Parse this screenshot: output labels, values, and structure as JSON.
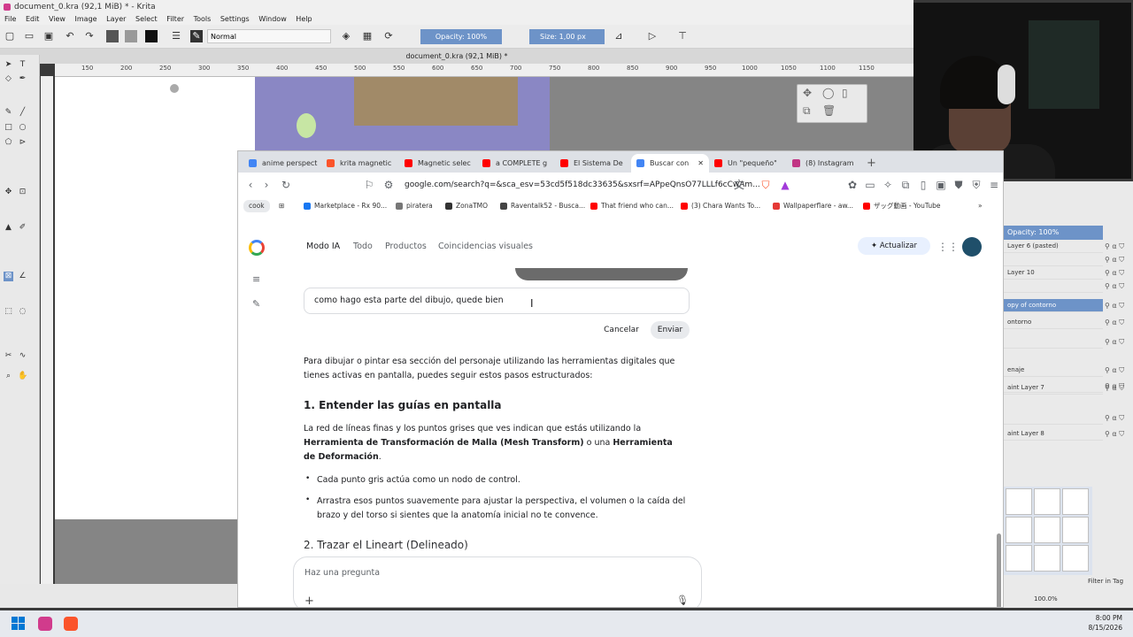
{
  "krita": {
    "title": "document_0.kra (92,1 MiB) * - Krita",
    "menu": [
      "File",
      "Edit",
      "View",
      "Image",
      "Layer",
      "Select",
      "Filter",
      "Tools",
      "Settings",
      "Window",
      "Help"
    ],
    "blend_mode": "Normal",
    "opacity": "Opacity: 100%",
    "size": "Size: 1,00 px",
    "doc_tab": "document_0.kra (92,1 MiB) *",
    "ruler": [
      "150",
      "200",
      "250",
      "300",
      "350",
      "400",
      "450",
      "500",
      "550",
      "600",
      "650",
      "700",
      "750",
      "800",
      "850",
      "900",
      "950",
      "1000",
      "1050",
      "1100",
      "1150"
    ],
    "layers": {
      "opacity": "Opacity: 100%",
      "items": [
        "Layer 6 (pasted)",
        "",
        "Layer 10",
        "",
        "opy of contorno",
        "ontorno",
        "",
        "enaje",
        "",
        "aint Layer 7",
        "",
        "aint Layer 8"
      ]
    },
    "zoom": "100.0%",
    "filter": "Filter in Tag"
  },
  "browser": {
    "tabs": [
      {
        "label": "anime perspecti",
        "color": "#4285f4"
      },
      {
        "label": "krita magnetic",
        "color": "#fb542b"
      },
      {
        "label": "Magnetic selec",
        "color": "#ff0000"
      },
      {
        "label": "a COMPLETE g",
        "color": "#ff0000"
      },
      {
        "label": "El Sistema De",
        "color": "#ff0000"
      },
      {
        "label": "Buscar con",
        "color": "#4285f4"
      },
      {
        "label": "Un \"pequeño\"",
        "color": "#ff0000"
      },
      {
        "label": "(8) Instagram",
        "color": "#c13584"
      }
    ],
    "url": "google.com/search?q=&sca_esv=53cd5f518dc33635&sxsrf=APpeQnsO77LLLf6cCwAm...",
    "bookmarks": [
      {
        "label": "cook",
        "color": ""
      },
      {
        "label": "Marketplace - Rx 90...",
        "color": "#1877f2"
      },
      {
        "label": "piratera",
        "color": "#777777"
      },
      {
        "label": "ZonaTMO",
        "color": "#333333"
      },
      {
        "label": "Raventalk52 - Busca...",
        "color": "#444444"
      },
      {
        "label": "That friend who can...",
        "color": "#ff0000"
      },
      {
        "label": "(3) Chara Wants To...",
        "color": "#ff0000"
      },
      {
        "label": "Wallpaperflare - aw...",
        "color": "#e53935"
      },
      {
        "label": "ザッグ動画 - YouTube",
        "color": "#ff0000"
      }
    ]
  },
  "google": {
    "nav": [
      "Modo IA",
      "Todo",
      "Productos",
      "Coincidencias visuales"
    ],
    "update_button": "✦ Actualizar",
    "edit_text": "como hago esta parte del dibujo, quede bien",
    "cancel": "Cancelar",
    "send": "Enviar",
    "intro": "Para dibujar o pintar esa sección del personaje utilizando las herramientas digitales que tienes activas en pantalla, puedes seguir estos pasos estructurados:",
    "h1": "1. Entender las guías en pantalla",
    "p1_a": "La red de líneas finas y los puntos grises que ves indican que estás utilizando la ",
    "p1_b": "Herramienta de Transformación de Malla (Mesh Transform)",
    "p1_c": " o una ",
    "p1_d": "Herramienta de Deformación",
    "p1_e": ".",
    "bullets": [
      "Cada punto gris actúa como un nodo de control.",
      "Arrastra esos puntos suavemente para ajustar la perspectiva, el volumen o la caída del brazo y del torso si sientes que la anatomía inicial no te convence."
    ],
    "h2": "2. Trazar el Lineart (Delineado)",
    "ask_placeholder": "Haz una pregunta"
  },
  "taskbar": {
    "time": "8:00 PM",
    "date": "8/15/2026"
  }
}
